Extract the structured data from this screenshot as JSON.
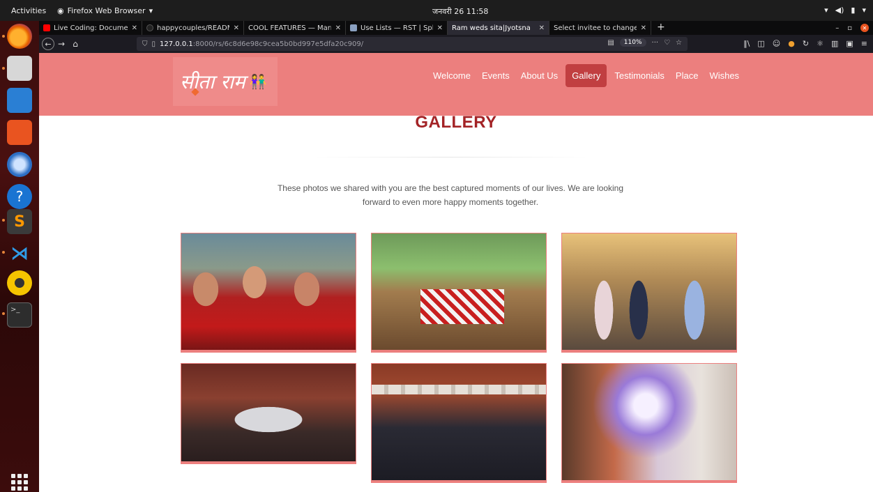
{
  "topbar": {
    "activities": "Activities",
    "app_name": "Firefox Web Browser",
    "clock": "जनवरी 26  11:58"
  },
  "browser": {
    "tabs": [
      {
        "label": "Live Coding: Documenta",
        "favicon_color": "#ff0000",
        "active": false
      },
      {
        "label": "happycouples/README.",
        "favicon_color": "#222222",
        "active": false
      },
      {
        "label": "COOL FEATURES — Marriag",
        "favicon_color": "#444444",
        "active": false
      },
      {
        "label": "Use Lists — RST | Sphinx",
        "favicon_color": "#8aa0c0",
        "active": false
      },
      {
        "label": "Ram weds sita|Jyotsna",
        "favicon_color": "#2b2a33",
        "active": true
      },
      {
        "label": "Select invitee to change | D",
        "favicon_color": "#333333",
        "active": false
      }
    ],
    "url_host": "127.0.0.1",
    "url_path": ":8000/rs/6c8d6e98c9cea5b0bd997e5dfa20c909/",
    "zoom": "110%"
  },
  "site": {
    "logo_text": "सीता राम",
    "nav": [
      {
        "label": "Welcome",
        "active": false
      },
      {
        "label": "Events",
        "active": false
      },
      {
        "label": "About Us",
        "active": false
      },
      {
        "label": "Gallery",
        "active": true
      },
      {
        "label": "Testimonials",
        "active": false
      },
      {
        "label": "Place",
        "active": false
      },
      {
        "label": "Wishes",
        "active": false
      }
    ],
    "gallery_title": "GALLERY",
    "intro_line1": "These photos we shared with you are the best captured moments of our lives. We are looking",
    "intro_line2": "forward to even more happy moments together.",
    "accent_color": "#ec7f7e",
    "title_color": "#a32326"
  }
}
